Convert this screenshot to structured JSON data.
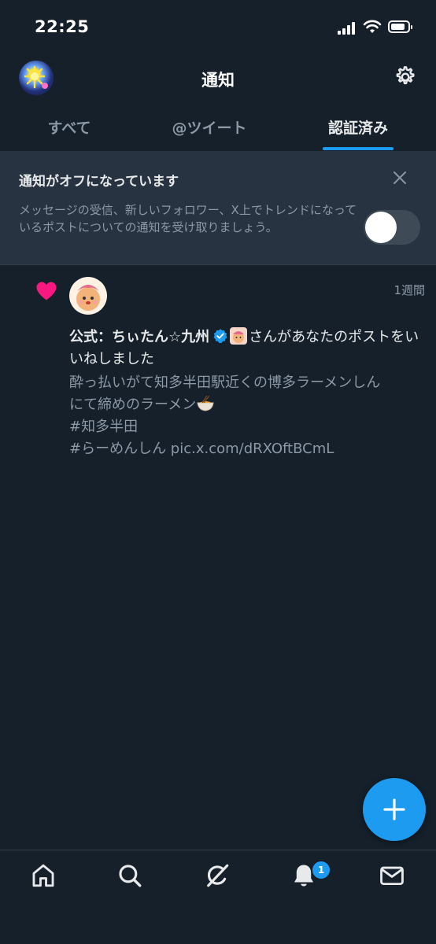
{
  "status_bar": {
    "time": "22:25"
  },
  "header": {
    "title": "通知"
  },
  "tabs": [
    {
      "label": "すべて",
      "active": false
    },
    {
      "label": "@ツイート",
      "active": false
    },
    {
      "label": "認証済み",
      "active": true
    }
  ],
  "banner": {
    "title": "通知がオフになっています",
    "description": "メッセージの受信、新しいフォロワー、X上でトレンドになっているポストについての通知を受け取りましょう。",
    "toggle_on": false
  },
  "notification": {
    "time_ago": "1週間",
    "user_name": "公式：ちぃたん☆九州",
    "action_text": "さんがあなたのポストをいいねしました",
    "post_lines": [
      "酔っ払いがて知多半田駅近くの博多ラーメンしん",
      "にて締めのラーメン",
      "#知多半田",
      "#らーめんしん pic.x.com/dRXOftBCmL"
    ]
  },
  "bottom_nav": {
    "notifications_badge": "1"
  },
  "colors": {
    "accent": "#1d9bf0",
    "like": "#f91880",
    "background": "#15202b"
  },
  "icons": {
    "settings": "gear-icon",
    "close": "close-icon",
    "like": "heart-icon",
    "verified": "verified-badge-icon",
    "compose": "plus-icon",
    "nav": [
      "home-icon",
      "search-icon",
      "grok-icon",
      "bell-icon",
      "mail-icon"
    ]
  }
}
